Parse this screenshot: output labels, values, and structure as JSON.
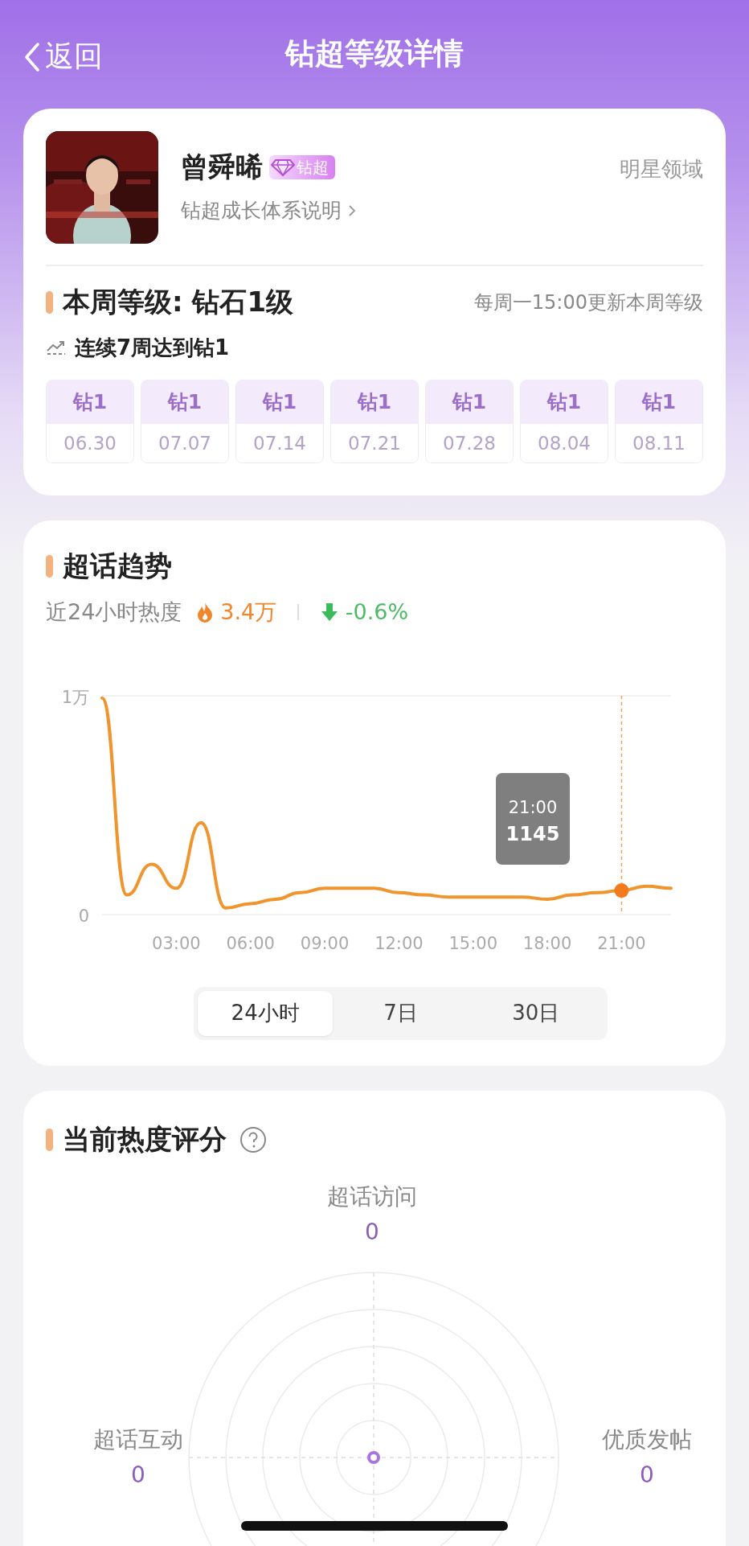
{
  "nav": {
    "back": "返回",
    "title": "钻超等级详情"
  },
  "profile": {
    "name": "曾舜晞",
    "badge": "钻超",
    "link": "钻超成长体系说明",
    "domain": "明星领域"
  },
  "level": {
    "title": "本周等级: 钻石1级",
    "note": "每周一15:00更新本周等级",
    "streak": "连续7周达到钻1",
    "weeks": [
      {
        "grade": "钻1",
        "date": "06.30"
      },
      {
        "grade": "钻1",
        "date": "07.07"
      },
      {
        "grade": "钻1",
        "date": "07.14"
      },
      {
        "grade": "钻1",
        "date": "07.21"
      },
      {
        "grade": "钻1",
        "date": "07.28"
      },
      {
        "grade": "钻1",
        "date": "08.04"
      },
      {
        "grade": "钻1",
        "date": "08.11"
      }
    ]
  },
  "trend": {
    "title": "超话趋势",
    "label": "近24小时热度",
    "heat": "3.4万",
    "change": "-0.6%",
    "tooltip": {
      "time": "21:00",
      "value": "1145"
    },
    "chart_data": {
      "type": "line",
      "x": [
        0,
        1,
        2,
        3,
        4,
        5,
        6,
        7,
        8,
        9,
        10,
        11,
        12,
        13,
        14,
        15,
        16,
        17,
        18,
        19,
        20,
        21,
        22,
        23
      ],
      "series": [
        {
          "color": "#f0952e",
          "values": [
            0.99,
            0.09,
            0.23,
            0.12,
            0.42,
            0.03,
            0.05,
            0.07,
            0.1,
            0.12,
            0.12,
            0.12,
            0.1,
            0.09,
            0.08,
            0.08,
            0.08,
            0.08,
            0.07,
            0.09,
            0.1,
            0.11,
            0.13,
            0.12
          ]
        }
      ],
      "xlim": [
        0,
        23
      ],
      "ref_lines": [
        {
          "axis": "x",
          "value": 21
        }
      ],
      "ylim": [
        0,
        1
      ],
      "yticks": [
        0,
        {
          "value": 1,
          "label": "1万"
        }
      ],
      "xticks": [
        {
          "value": 3,
          "label": "03:00"
        },
        {
          "value": 6,
          "label": "06:00"
        },
        {
          "value": 9,
          "label": "09:00"
        },
        {
          "value": 12,
          "label": "12:00"
        },
        {
          "value": 15,
          "label": "15:00"
        },
        {
          "value": 18,
          "label": "18:00"
        },
        {
          "value": 21,
          "label": "21:00"
        }
      ]
    },
    "ranges": [
      {
        "label": "24小时",
        "selected": true
      },
      {
        "label": "7日",
        "selected": false
      },
      {
        "label": "30日",
        "selected": false
      }
    ]
  },
  "score": {
    "title": "当前热度评分",
    "metrics": [
      {
        "label": "超话访问",
        "value": "0"
      },
      {
        "label": "超话互动",
        "value": "0"
      },
      {
        "label": "优质发帖",
        "value": "0"
      }
    ]
  }
}
